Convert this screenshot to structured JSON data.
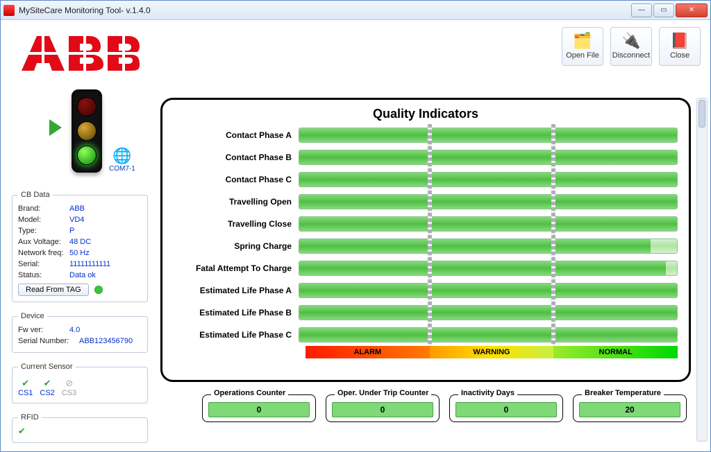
{
  "window": {
    "title": "MySiteCare Monitoring Tool- v.1.4.0"
  },
  "toolbar": {
    "open_file": "Open File",
    "disconnect": "Disconnect",
    "close": "Close"
  },
  "connection": {
    "port_label": "COM7-1"
  },
  "cb_data": {
    "legend": "CB Data",
    "brand_k": "Brand:",
    "brand_v": "ABB",
    "model_k": "Model:",
    "model_v": "VD4",
    "type_k": "Type:",
    "type_v": "P",
    "aux_k": "Aux Voltage:",
    "aux_v": "48   DC",
    "freq_k": "Network freq:",
    "freq_v": "50 Hz",
    "serial_k": "Serial:",
    "serial_v": "11111111111",
    "status_k": "Status:",
    "status_v": "Data ok",
    "read_tag_btn": "Read From TAG"
  },
  "device": {
    "legend": "Device",
    "fw_k": "Fw ver:",
    "fw_v": "4.0",
    "sn_k": "Serial Number:",
    "sn_v": "ABB123456790"
  },
  "current_sensor": {
    "legend": "Current Sensor",
    "cs1": "CS1",
    "cs2": "CS2",
    "cs3": "CS3"
  },
  "rfid": {
    "legend": "RFID"
  },
  "quality": {
    "title": "Quality Indicators",
    "rows": [
      "Contact Phase A",
      "Contact Phase B",
      "Contact Phase C",
      "Travelling Open",
      "Travelling Close",
      "Spring Charge",
      "Fatal Attempt To Charge",
      "Estimated Life Phase A",
      "Estimated Life Phase B",
      "Estimated Life Phase C"
    ],
    "zones": {
      "alarm": "ALARM",
      "warning": "WARNING",
      "normal": "NORMAL"
    }
  },
  "counters": [
    {
      "title": "Operations Counter",
      "value": "0"
    },
    {
      "title": "Oper. Under Trip Counter",
      "value": "0"
    },
    {
      "title": "Inactivity Days",
      "value": "0"
    },
    {
      "title": "Breaker Temperature",
      "value": "20"
    }
  ],
  "chart_data": {
    "type": "bar",
    "title": "Quality Indicators",
    "categories": [
      "Contact Phase A",
      "Contact Phase B",
      "Contact Phase C",
      "Travelling Open",
      "Travelling Close",
      "Spring Charge",
      "Fatal Attempt To Charge",
      "Estimated Life Phase A",
      "Estimated Life Phase B",
      "Estimated Life Phase C"
    ],
    "values": [
      100,
      100,
      100,
      100,
      100,
      93,
      97,
      100,
      100,
      100
    ],
    "zones": [
      {
        "name": "ALARM",
        "range": [
          0,
          33.3
        ]
      },
      {
        "name": "WARNING",
        "range": [
          33.3,
          66.6
        ]
      },
      {
        "name": "NORMAL",
        "range": [
          66.6,
          100
        ]
      }
    ],
    "xlabel": "",
    "ylabel": "",
    "ylim": [
      0,
      100
    ]
  }
}
